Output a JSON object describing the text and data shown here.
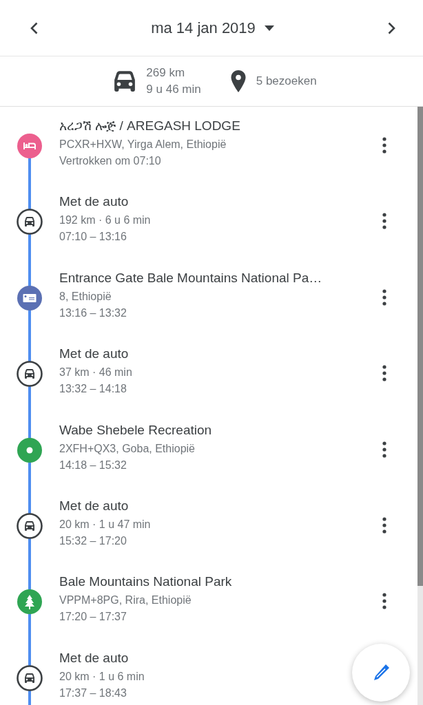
{
  "header": {
    "date": "ma 14 jan 2019"
  },
  "summary": {
    "distance": "269 km",
    "duration": "9 u 46 min",
    "visits": "5 bezoeken"
  },
  "timeline": [
    {
      "kind": "lodging",
      "color": "#ec5f8e",
      "title": "አረጋሽ ሎጅ / AREGASH LODGE",
      "line_1": "PCXR+HXW, Yirga Alem, Ethiopië",
      "line_2": "Vertrokken om 07:10"
    },
    {
      "kind": "drive",
      "title": "Met de auto",
      "line_1": "192 km · 6 u 6 min",
      "line_2": "07:10 – 13:16"
    },
    {
      "kind": "gate",
      "color": "#5b70b3",
      "title": "Entrance Gate Bale Mountains National Pa…",
      "line_1": "8, Ethiopië",
      "line_2": "13:16 – 13:32"
    },
    {
      "kind": "drive",
      "title": "Met de auto",
      "line_1": "37 km · 46 min",
      "line_2": "13:32 – 14:18"
    },
    {
      "kind": "place",
      "color": "#2fa553",
      "title": "Wabe Shebele Recreation",
      "line_1": "2XFH+QX3, Goba, Ethiopië",
      "line_2": "14:18 – 15:32"
    },
    {
      "kind": "drive",
      "title": "Met de auto",
      "line_1": "20 km · 1 u 47 min",
      "line_2": "15:32 – 17:20"
    },
    {
      "kind": "park",
      "color": "#2fa553",
      "title": "Bale Mountains National Park",
      "line_1": "VPPM+8PG, Rira, Ethiopië",
      "line_2": "17:20 – 17:37"
    },
    {
      "kind": "drive",
      "title": "Met de auto",
      "line_1": "20 km · 1 u 6 min",
      "line_2": "17:37 – 18:43"
    }
  ]
}
